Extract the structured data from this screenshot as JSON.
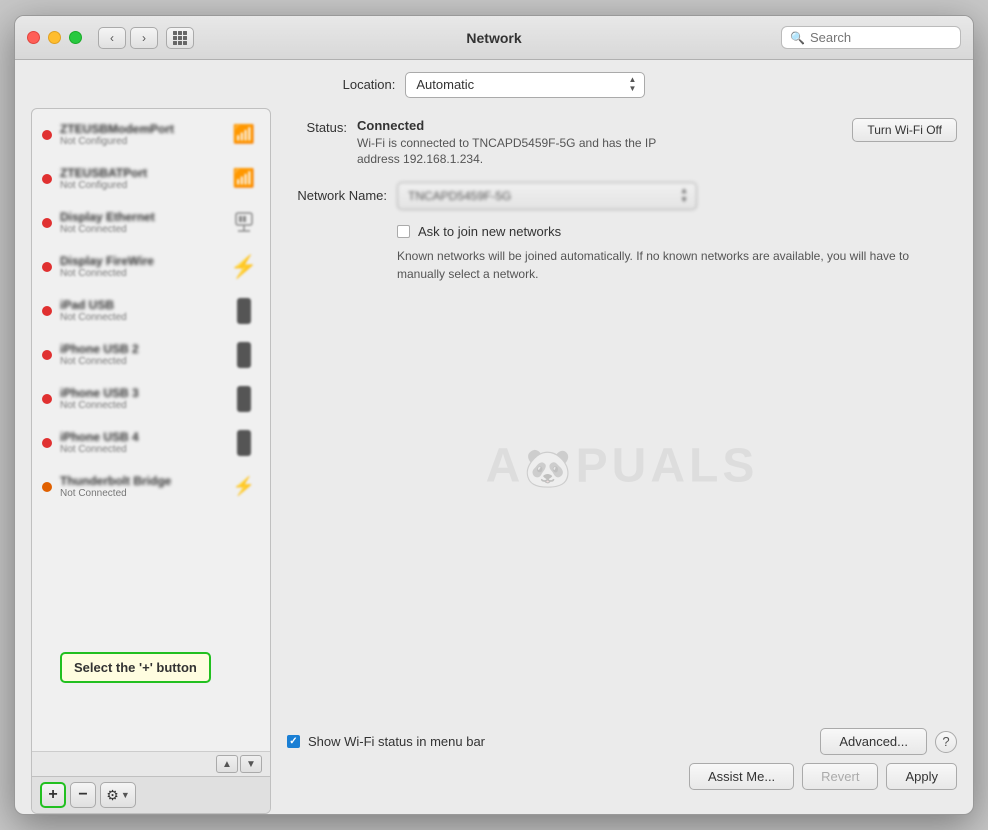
{
  "window": {
    "title": "Network",
    "search_placeholder": "Search"
  },
  "location": {
    "label": "Location:",
    "value": "Automatic"
  },
  "sidebar": {
    "items": [
      {
        "name": "ZTEUSBModemPort",
        "status": "Not Configured",
        "dot": "red",
        "icon": "wifi"
      },
      {
        "name": "ZTEUSBATPort",
        "status": "Not Configured",
        "dot": "red",
        "icon": "wifi2"
      },
      {
        "name": "Display Ethernet",
        "status": "Not Connected",
        "dot": "red",
        "icon": "ethernet"
      },
      {
        "name": "Display FireWire",
        "status": "Not Connected",
        "dot": "red",
        "icon": "firewire"
      },
      {
        "name": "iPad USB",
        "status": "Not Connected",
        "dot": "red",
        "icon": "iphone"
      },
      {
        "name": "iPhone USB 2",
        "status": "Not Connected",
        "dot": "red",
        "icon": "iphone"
      },
      {
        "name": "iPhone USB 3",
        "status": "Not Connected",
        "dot": "red",
        "icon": "iphone"
      },
      {
        "name": "iPhone USB 4",
        "status": "Not Connected",
        "dot": "red",
        "icon": "iphone"
      },
      {
        "name": "Thunderbolt Bridge",
        "status": "Not Connected",
        "dot": "orange",
        "icon": "thunderbolt"
      }
    ],
    "toolbar": {
      "add_label": "+",
      "remove_label": "−",
      "gear_label": "⚙"
    }
  },
  "detail": {
    "status_label": "Status:",
    "status_value": "Connected",
    "turn_wifi_label": "Turn Wi-Fi Off",
    "status_description": "Wi-Fi is connected to TNCAPD5459F-5G and has the IP address 192.168.1.234.",
    "network_name_label": "Network Name:",
    "network_name_value": "TNCAPD5459F-5G",
    "ask_to_join_label": "Ask to join new networks",
    "ask_to_join_desc": "Known networks will be joined automatically. If no known networks are available, you will have to manually select a network.",
    "show_wifi_label": "Show Wi-Fi status in menu bar",
    "advanced_label": "Advanced...",
    "help_label": "?",
    "assist_label": "Assist Me...",
    "revert_label": "Revert",
    "apply_label": "Apply"
  },
  "tooltip": {
    "text": "Select the '+' button"
  },
  "watermark": {
    "text": "APPUALS"
  }
}
